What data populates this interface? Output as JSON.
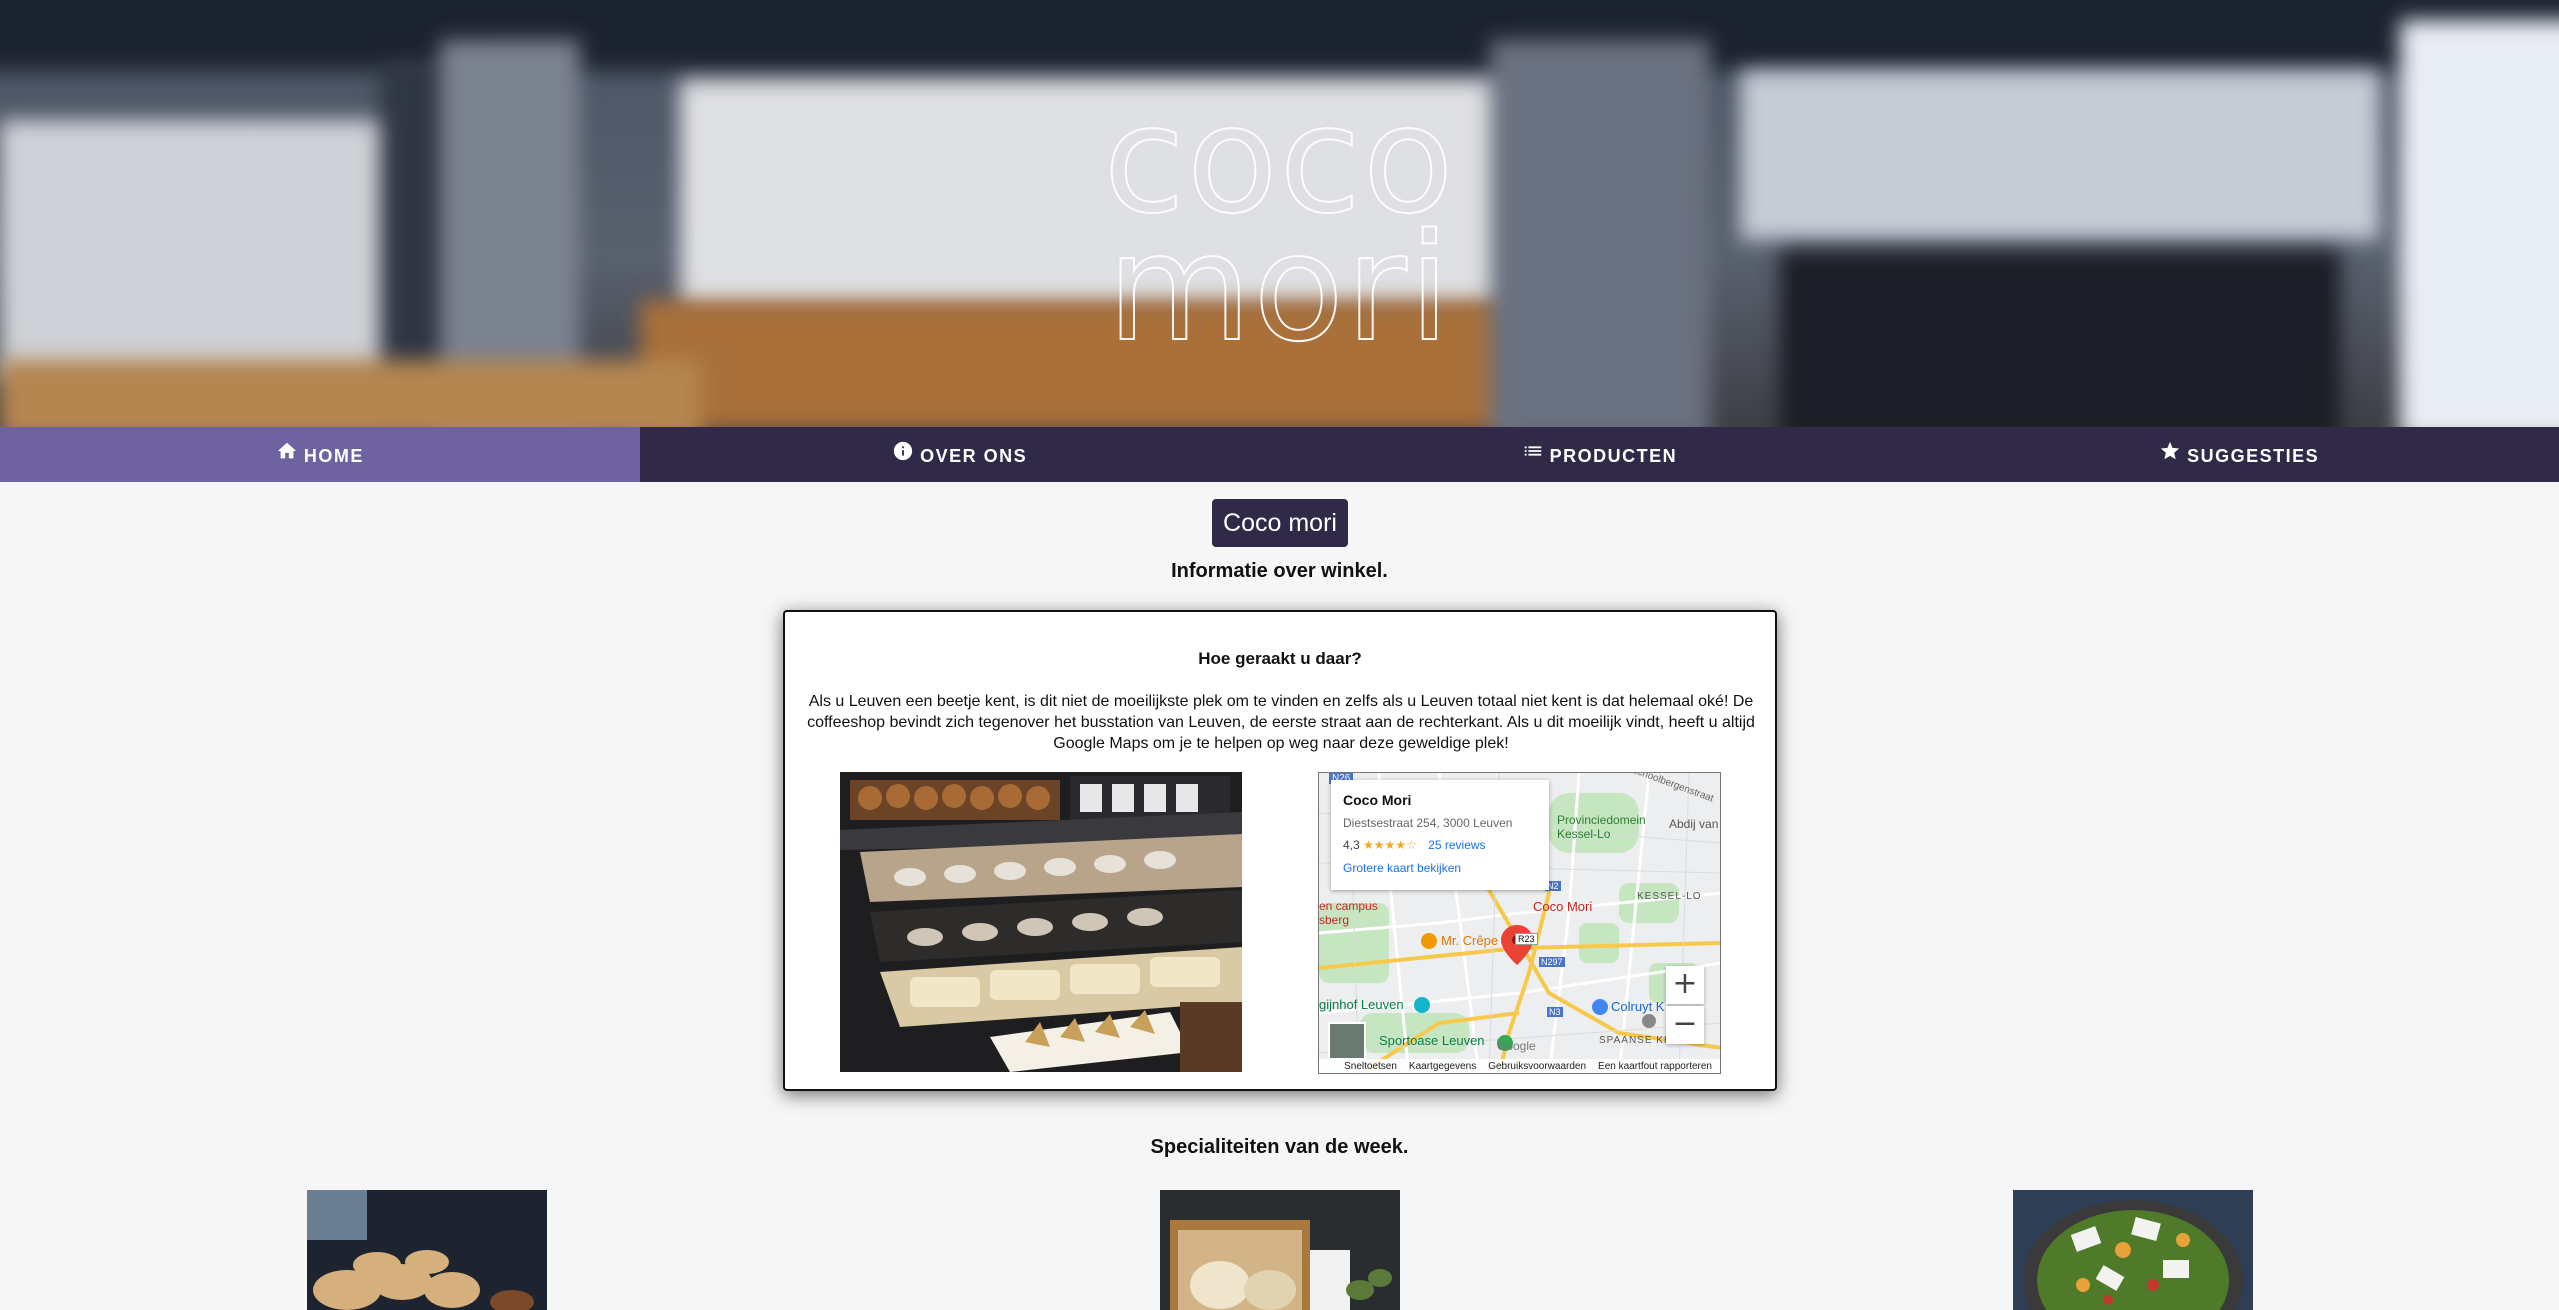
{
  "hero": {
    "logo_line1": "coco",
    "logo_line2": "mori"
  },
  "nav": {
    "items": [
      {
        "label": "HOME",
        "icon": "home-icon",
        "active": true
      },
      {
        "label": "OVER ONS",
        "icon": "info-icon",
        "active": false
      },
      {
        "label": "PRODUCTEN",
        "icon": "list-icon",
        "active": false
      },
      {
        "label": "SUGGESTIES",
        "icon": "star-icon",
        "active": false
      }
    ]
  },
  "main": {
    "badge": "Coco mori",
    "subtitle": "Informatie over winkel.",
    "card": {
      "title": "Hoe geraakt u daar?",
      "text": "Als u Leuven een beetje kent, is dit niet de moeilijkste plek om te vinden en zelfs als u Leuven totaal niet kent is dat helemaal oké! De coffeeshop bevindt zich tegenover het busstation van Leuven, de eerste straat aan de rechterkant. Als u dit moeilijk vindt, heeft u altijd Google Maps om je te helpen op weg naar deze geweldige plek!"
    },
    "specialties_title": "Specialiteiten van de week."
  },
  "map": {
    "place_name": "Coco Mori",
    "address": "Diestsestraat 254, 3000 Leuven",
    "rating": "4,3",
    "stars": "★★★★☆",
    "reviews_link": "25 reviews",
    "larger_map_link": "Grotere kaart bekijken",
    "marker_label": "Coco Mori",
    "labels": {
      "n26": "N26",
      "kessel_lo_domain": "Provinciedomein Kessel-Lo",
      "abdij": "Abdij van",
      "kessel_lo": "KESSEL-LO",
      "campus": "en campus",
      "sberg": "sberg",
      "mr_crepe": "Mr. Crêpe",
      "r23": "R23",
      "n2": "N2",
      "n297": "N297",
      "n3": "N3",
      "begijnhof": "gijnhof Leuven",
      "colruyt": "Colruyt K",
      "sportoase": "Sportoase Leuven",
      "spaanse": "SPAANSE KROO",
      "street": "Schoolbergenstraat",
      "google": "Google"
    },
    "zoom_in": "+",
    "zoom_out": "−",
    "footer": [
      "Sneltoetsen",
      "Kaartgegevens",
      "Gebruiksvoorwaarden",
      "Een kaartfout rapporteren"
    ]
  },
  "colors": {
    "nav_bg": "#302a48",
    "nav_active": "#6e62a0",
    "page_bg": "#f6f6f6"
  }
}
